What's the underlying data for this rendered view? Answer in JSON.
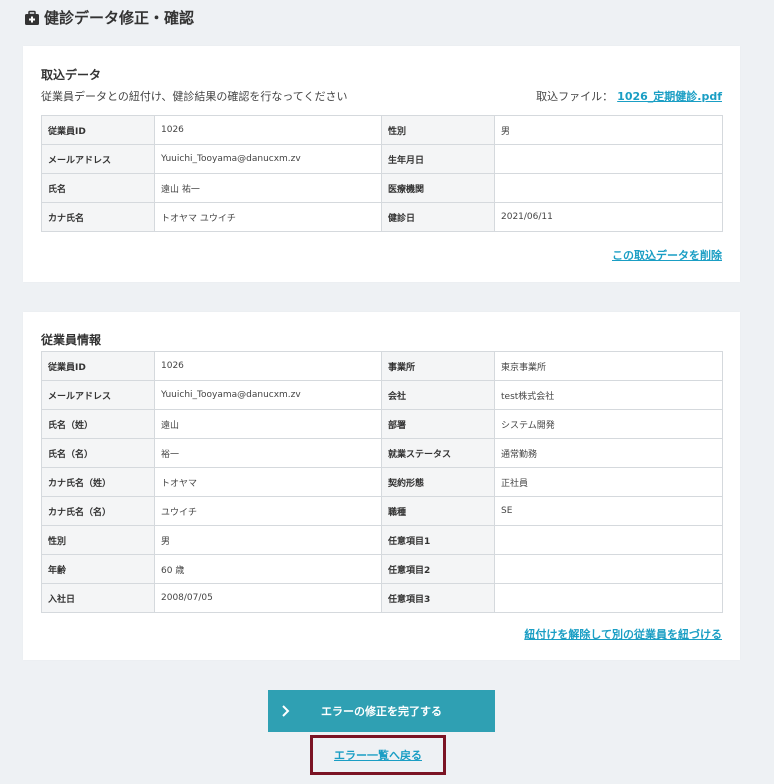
{
  "page": {
    "title": "健診データ修正・確認"
  },
  "import_section": {
    "title": "取込データ",
    "description": "従業員データとの紐付け、健診結果の確認を行なってください",
    "file_label": "取込ファイル：",
    "file_name": "1026_定期健診.pdf",
    "rows": [
      {
        "l1": "従業員ID",
        "v1": "1026",
        "l2": "性別",
        "v2": "男"
      },
      {
        "l1": "メールアドレス",
        "v1": "Yuuichi_Tooyama@danucxm.zv",
        "l2": "生年月日",
        "v2": ""
      },
      {
        "l1": "氏名",
        "v1": "遠山 祐一",
        "l2": "医療機関",
        "v2": ""
      },
      {
        "l1": "カナ氏名",
        "v1": "トオヤマ ユウイチ",
        "l2": "健診日",
        "v2": "2021/06/11"
      }
    ],
    "delete_link": "この取込データを削除"
  },
  "employee_section": {
    "title": "従業員情報",
    "rows": [
      {
        "l1": "従業員ID",
        "v1": "1026",
        "l2": "事業所",
        "v2": "東京事業所"
      },
      {
        "l1": "メールアドレス",
        "v1": "Yuuichi_Tooyama@danucxm.zv",
        "l2": "会社",
        "v2": "test株式会社"
      },
      {
        "l1": "氏名（姓）",
        "v1": "遠山",
        "l2": "部署",
        "v2": "システム開発"
      },
      {
        "l1": "氏名（名）",
        "v1": "裕一",
        "l2": "就業ステータス",
        "v2": "通常勤務"
      },
      {
        "l1": "カナ氏名（姓）",
        "v1": "トオヤマ",
        "l2": "契約形態",
        "v2": "正社員"
      },
      {
        "l1": "カナ氏名（名）",
        "v1": "ユウイチ",
        "l2": "職種",
        "v2": "SE"
      },
      {
        "l1": "性別",
        "v1": "男",
        "l2": "任意項目1",
        "v2": ""
      },
      {
        "l1": "年齢",
        "v1": "60 歳",
        "l2": "任意項目2",
        "v2": ""
      },
      {
        "l1": "入社日",
        "v1": "2008/07/05",
        "l2": "任意項目3",
        "v2": ""
      }
    ],
    "relink_link": "紐付けを解除して別の従業員を紐づける"
  },
  "actions": {
    "complete_button": "エラーの修正を完了する",
    "back_link": "エラー一覧へ戻る"
  },
  "colors": {
    "accent": "#1a9ec4",
    "button": "#2fa0b3",
    "highlight_border": "#7b1424",
    "background": "#eef1f4"
  },
  "icons": {
    "title_icon": "medical-kit-icon",
    "button_icon": "chevron-right-icon"
  }
}
